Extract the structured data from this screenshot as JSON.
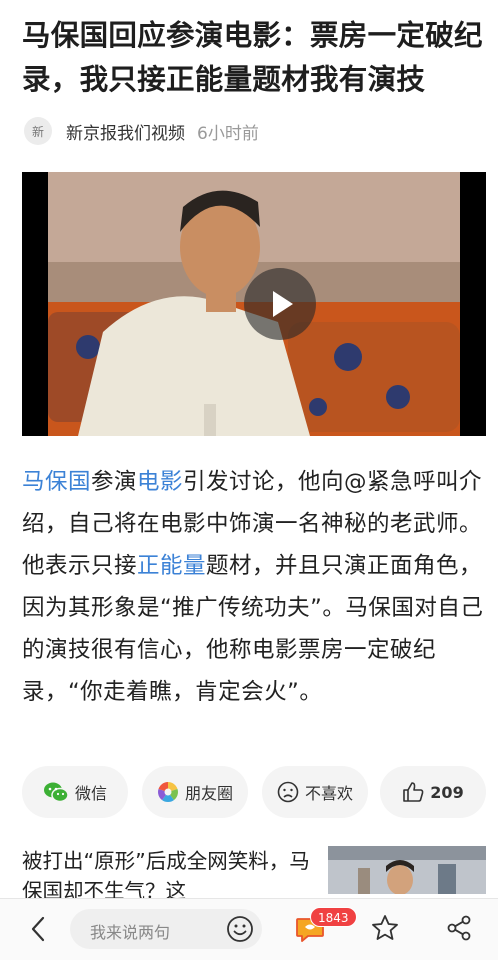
{
  "article": {
    "title": "马保国回应参演电影：票房一定破纪录，我只接正能量题材我有演技",
    "source": {
      "avatar_text": "新",
      "name": "新京报我们视频",
      "time": "6小时前"
    },
    "video": {
      "play_icon": "play-icon"
    },
    "body": [
      {
        "text": "马保国",
        "link": true
      },
      {
        "text": "参演",
        "link": false
      },
      {
        "text": "电影",
        "link": true
      },
      {
        "text": "引发讨论，他向@紧急呼叫介绍，自己将在电影中饰演一名神秘的老武师。他表示只接",
        "link": false
      },
      {
        "text": "正能量",
        "link": true
      },
      {
        "text": "题材，并且只演正面角色，因为其形象是“推广传统功夫”。马保国对自己的演技很有信心，他称电影票房一定破纪录，“你走着瞧，肯定会火”。",
        "link": false
      }
    ]
  },
  "share_actions": [
    {
      "label": "微信",
      "icon": "wechat-icon"
    },
    {
      "label": "朋友圈",
      "icon": "moments-icon"
    },
    {
      "label": "不喜欢",
      "icon": "dislike-face-icon"
    },
    {
      "label": "209",
      "icon": "thumbs-up-icon"
    }
  ],
  "recommendation": {
    "title": "被打出“原形”后成全网笑料，马保国却不生气？这"
  },
  "bottom_bar": {
    "comment_placeholder": "我来说两句",
    "comment_count": "1843",
    "icons": [
      "back-icon",
      "emoji-icon",
      "comments-icon",
      "star-icon",
      "share-icon"
    ]
  },
  "colors": {
    "link": "#3c82d6",
    "badge": "#f04142",
    "wechat": "#3cb035"
  }
}
